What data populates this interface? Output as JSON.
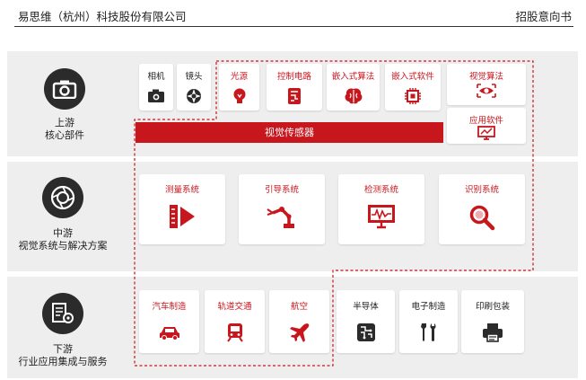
{
  "header": {
    "company": "易思维（杭州）科技股份有限公司",
    "doc_type": "招股意向书"
  },
  "upstream": {
    "title": "上游",
    "subtitle": "核心部件",
    "cards": [
      {
        "label": "相机",
        "icon": "camera-icon",
        "highlight": false
      },
      {
        "label": "镜头",
        "icon": "lens-aperture-icon",
        "highlight": false
      },
      {
        "label": "光源",
        "icon": "lightbulb-icon",
        "highlight": true
      },
      {
        "label": "控制电路",
        "icon": "circuit-board-icon",
        "highlight": true
      },
      {
        "label": "嵌入式算法",
        "icon": "brain-icon",
        "highlight": true
      },
      {
        "label": "嵌入式软件",
        "icon": "chip-icon",
        "highlight": true
      },
      {
        "label": "视觉算法",
        "icon": "eye-scan-icon",
        "highlight": true
      },
      {
        "label": "应用软件",
        "icon": "monitor-app-icon",
        "highlight": true
      }
    ],
    "sensor_bar": "视觉传感器"
  },
  "midstream": {
    "title": "中游",
    "subtitle": "视觉系统与解决方案",
    "cards": [
      {
        "label": "测量系统",
        "icon": "measure-system-icon"
      },
      {
        "label": "引导系统",
        "icon": "robot-arm-icon"
      },
      {
        "label": "检测系统",
        "icon": "waveform-monitor-icon"
      },
      {
        "label": "识别系统",
        "icon": "magnifier-icon"
      }
    ]
  },
  "downstream": {
    "title": "下游",
    "subtitle": "行业应用集成与服务",
    "cards": [
      {
        "label": "汽车制造",
        "icon": "car-icon",
        "highlight": true
      },
      {
        "label": "轨道交通",
        "icon": "train-icon",
        "highlight": true
      },
      {
        "label": "航空",
        "icon": "airplane-icon",
        "highlight": true
      },
      {
        "label": "半导体",
        "icon": "semiconductor-icon",
        "highlight": false
      },
      {
        "label": "电子制造",
        "icon": "tools-icon",
        "highlight": false
      },
      {
        "label": "印刷包装",
        "icon": "printer-icon",
        "highlight": false
      }
    ]
  },
  "colors": {
    "accent_red": "#c8161d",
    "dark": "#2b2b2b",
    "band_bg": "#eeeeee"
  }
}
